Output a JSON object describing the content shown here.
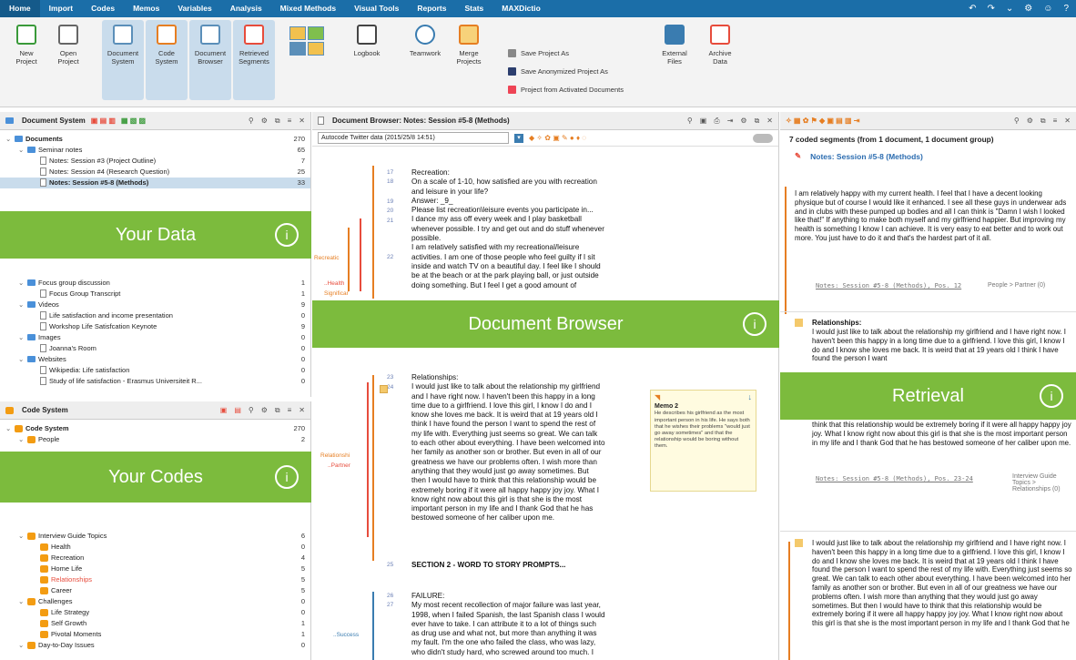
{
  "menu": {
    "items": [
      "Home",
      "Import",
      "Codes",
      "Memos",
      "Variables",
      "Analysis",
      "Mixed Methods",
      "Visual Tools",
      "Reports",
      "Stats",
      "MAXDictio"
    ]
  },
  "ribbon": {
    "new_project": "New\nProject",
    "open_project": "Open\nProject",
    "document_system": "Document\nSystem",
    "code_system": "Code\nSystem",
    "document_browser": "Document\nBrowser",
    "retrieved_segments": "Retrieved\nSegments",
    "logbook": "Logbook",
    "teamwork": "Teamwork",
    "merge_projects": "Merge\nProjects",
    "save_project_as": "Save Project As",
    "save_anonymized": "Save Anonymized Project As",
    "project_from_activated": "Project from Activated Documents",
    "external_files": "External\nFiles",
    "archive_data": "Archive\nData"
  },
  "document_system": {
    "title": "Document System",
    "rows": [
      {
        "label": "Documents",
        "count": "270",
        "level": 0
      },
      {
        "label": "Seminar notes",
        "count": "65",
        "level": 1
      },
      {
        "label": "Notes: Session #3 (Project Outline)",
        "count": "7",
        "level": 2
      },
      {
        "label": "Notes: Session #4 (Research Question)",
        "count": "25",
        "level": 2
      },
      {
        "label": "Notes: Session #5-8 (Methods)",
        "count": "33",
        "level": 2
      },
      {
        "label": "Focus group discussion",
        "count": "1",
        "level": 1
      },
      {
        "label": "Focus Group Transcript",
        "count": "1",
        "level": 2
      },
      {
        "label": "Videos",
        "count": "9",
        "level": 1
      },
      {
        "label": "Life satisfaction and income presentation",
        "count": "0",
        "level": 2
      },
      {
        "label": "Workshop Life Satisfcation Keynote",
        "count": "9",
        "level": 2
      },
      {
        "label": "Images",
        "count": "0",
        "level": 1
      },
      {
        "label": "Joanna's Room",
        "count": "0",
        "level": 2
      },
      {
        "label": "Websites",
        "count": "0",
        "level": 1
      },
      {
        "label": "Wikipedia: Life satisfaction",
        "count": "0",
        "level": 2
      },
      {
        "label": "Study of life satisfaction - Erasmus Universiteit R...",
        "count": "0",
        "level": 2
      }
    ]
  },
  "code_system": {
    "title": "Code System",
    "rows": [
      {
        "label": "Code System",
        "count": "270",
        "level": 0
      },
      {
        "label": "People",
        "count": "2",
        "level": 1
      },
      {
        "label": "Interview Guide Topics",
        "count": "6",
        "level": 1
      },
      {
        "label": "Health",
        "count": "0",
        "level": 2
      },
      {
        "label": "Recreation",
        "count": "4",
        "level": 2
      },
      {
        "label": "Home Life",
        "count": "5",
        "level": 2
      },
      {
        "label": "Relationships",
        "count": "5",
        "level": 2
      },
      {
        "label": "Career",
        "count": "5",
        "level": 2
      },
      {
        "label": "Challenges",
        "count": "0",
        "level": 1
      },
      {
        "label": "Life Strategy",
        "count": "0",
        "level": 2
      },
      {
        "label": "Self Growth",
        "count": "1",
        "level": 2
      },
      {
        "label": "Pivotal Moments",
        "count": "1",
        "level": 2
      },
      {
        "label": "Day-to-Day Issues",
        "count": "0",
        "level": 1
      }
    ]
  },
  "browser": {
    "title": "Document Browser: Notes: Session #5-8 (Methods)",
    "autocode": "Autocode Twitter data (2015/25/8 14:51)",
    "para1": "Recreation:\nOn a scale of 1-10, how satisfied are you with recreation\n    and leisure in your life?\nAnswer: _9_\nPlease list recreation\\leisure events you participate in...\nI dance my ass off every week and I play basketball\nwhenever possible.  I try and get out and do stuff whenever\npossible.\n   I am relatively satisfied with my recreational/leisure\nactivities.  I am one of those people who feel guilty if I sit\ninside and watch TV on a beautiful day.  I feel like I should\nbe at the beach or at the park playing ball, or just outside\ndoing something.  But I feel I get a good amount of",
    "para2": "Relationships:\nI would just like to talk about the relationship my girlfriend\nand I have right now.  I haven't been this happy in a long\ntime due to a girlfriend.  I love this girl, I know I do and I\nknow she loves me back.  It is weird that at 19 years old I\nthink I have found the person I want to spend the rest of\nmy life with.  Everything just seems so great.  We can talk\nto each other about everything.  I have been welcomed into\nher family as another son or brother.  But even in all of our\ngreatness we have our problems often.  I wish more than\nanything that they would just go away sometimes.  But\nthen I would have to think that this relationship would be\nextremely boring if it were all happy happy joy joy.  What I\nknow right now about this girl is that she is the most\nimportant person in my life and I thank God that he has\nbestowed someone of her caliber upon me.",
    "section2": "SECTION 2 - WORD TO STORY PROMPTS...",
    "para3": "FAILURE:\nMy most recent recollection of major failure was last year,\n1998, when I failed Spanish, the last Spanish class I would\never have to take.  I can attribute it to a lot of things such\nas drug use and what not, but more than anything it was\nmy fault.  I'm the one who failed the class, who was lazy,\nwho didn't study hard, who screwed around too much.  I",
    "memo_title": "Memo 2",
    "memo_text": "He describes his girlfriend as the most important person in his life. He says both that he wishes their problems \"would just go away sometimes\" and that the relationship would be boring without them.",
    "codes": {
      "recreation": "Recreatic",
      "health": "..Health",
      "significant": "Significar",
      "relationship": "Relationshi",
      "partner": "..Partner",
      "success": "..Success"
    }
  },
  "retrieval": {
    "summary": "7 coded segments (from 1 document, 1 document group)",
    "doc": "Notes: Session #5-8 (Methods)",
    "seg1": "I am relatively happy with my current health.  I feel that I have a decent looking physique but of course I would like it enhanced.  I see all these guys in underwear ads and in clubs with these pumped up bodies and all I can think is \"Damn I wish I looked like that!\"  If anything to make both myself and my girlfriend happier.  But improving my health is something I know I can achieve.  It is very easy to eat better and to work out more.  You just have to do it and that's the hardest part of it all.",
    "src1": "Notes: Session #5-8 (Methods), Pos. 12",
    "code1": "People > Partner (0)",
    "seg2_title": "Relationships:",
    "seg2": "I would just like to talk about the relationship my girlfriend and I have right now.  I haven't been this happy in a long time due to a girlfriend.  I love this girl, I know I do and I know she loves me back.  It is weird that at 19 years old I think I have found the person I want",
    "seg2b": "think that this relationship would be extremely boring if it were all happy happy joy joy.  What I know right now about this girl is that she is the most important person in my life and I thank God that he has bestowed someone of her caliber upon me.",
    "src2": "Notes: Session #5-8 (Methods), Pos. 23-24",
    "code2": "Interview Guide Topics > Relationships (0)",
    "seg3": "I would just like to talk about the relationship my girlfriend and I have right now.  I haven't been this happy in a long time due to a girlfriend.  I love this girl, I know I do and I know she loves me back.  It is weird that at 19 years old I think I have found the person I want to spend the rest of my life with.  Everything just seems so great.  We can talk to each other about everything.  I have been welcomed into her family as another son or brother.  But even in all of our greatness we have our problems often.  I wish more than anything that they would just go away sometimes.  But then I would have to think that this relationship would be extremely boring if it were all happy happy joy joy.  What I know right now about this girl is that she is the most important person in my life and I thank God that he"
  },
  "overlays": {
    "your_data": "Your Data",
    "document_browser": "Document Browser",
    "retrieval": "Retrieval",
    "your_codes": "Your Codes",
    "info": "i"
  },
  "colors": {
    "menubar": "#1b6ea8",
    "overlay": "#6eb428",
    "accent": "#e74c3c"
  }
}
